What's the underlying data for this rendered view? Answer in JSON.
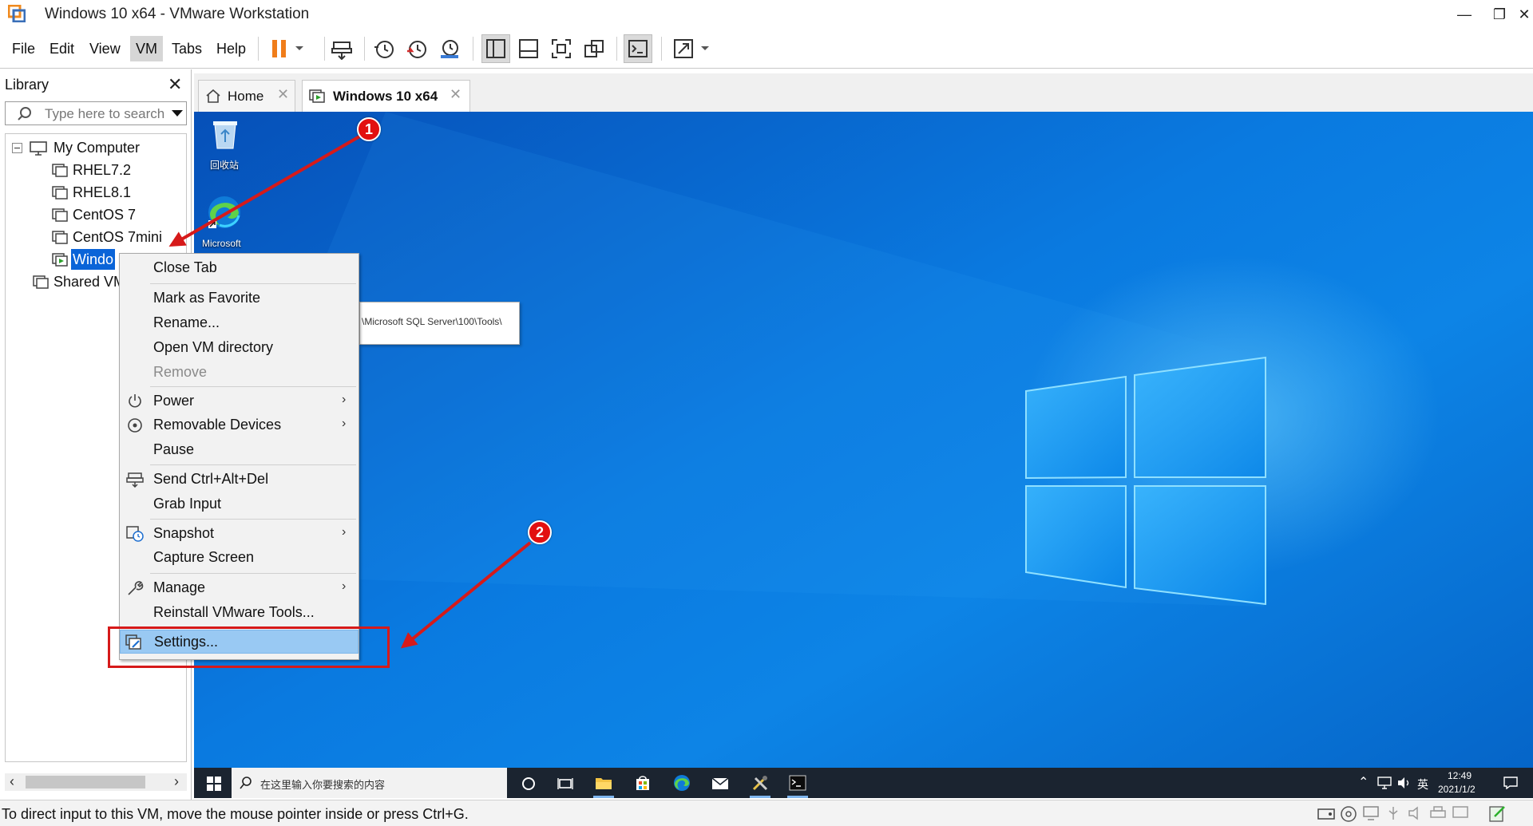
{
  "window": {
    "title": "Windows 10 x64 - VMware Workstation"
  },
  "menu": [
    "File",
    "Edit",
    "View",
    "VM",
    "Tabs",
    "Help"
  ],
  "library": {
    "title": "Library",
    "search_placeholder": "Type here to search",
    "tree": [
      {
        "label": "My Computer"
      },
      {
        "label": "RHEL7.2"
      },
      {
        "label": "RHEL8.1"
      },
      {
        "label": "CentOS 7"
      },
      {
        "label": "CentOS 7mini"
      },
      {
        "label": "Windo"
      },
      {
        "label": "Shared VM"
      }
    ]
  },
  "tabs": [
    {
      "label": "Home"
    },
    {
      "label": "Windows 10 x64"
    }
  ],
  "desktop": {
    "icons": [
      {
        "label": "回收站"
      },
      {
        "label": "Microsoft"
      }
    ],
    "tooltip": "\\Microsoft SQL Server\\100\\Tools\\"
  },
  "context_menu": {
    "items": [
      {
        "label": "Close Tab"
      },
      {
        "label": "Mark as Favorite"
      },
      {
        "label": "Rename..."
      },
      {
        "label": "Open VM directory"
      },
      {
        "label": "Remove",
        "disabled": true
      },
      {
        "label": "Power",
        "submenu": true
      },
      {
        "label": "Removable Devices",
        "submenu": true
      },
      {
        "label": "Pause"
      },
      {
        "label": "Send Ctrl+Alt+Del"
      },
      {
        "label": "Grab Input"
      },
      {
        "label": "Snapshot",
        "submenu": true
      },
      {
        "label": "Capture Screen"
      },
      {
        "label": "Manage",
        "submenu": true
      },
      {
        "label": "Reinstall VMware Tools..."
      },
      {
        "label": "Settings..."
      }
    ]
  },
  "guest_taskbar": {
    "search_placeholder": "在这里输入你要搜索的内容",
    "ime": "英",
    "time": "12:49",
    "date": "2021/1/2"
  },
  "annotations": {
    "step1": "1",
    "step2": "2"
  },
  "statusbar": {
    "text": "To direct input to this VM, move the mouse pointer inside or press Ctrl+G."
  },
  "colors": {
    "accent": "#0a64d8",
    "annotation": "#e21010",
    "menu_highlight": "#99c9f3",
    "pause": "#f07d1a"
  }
}
